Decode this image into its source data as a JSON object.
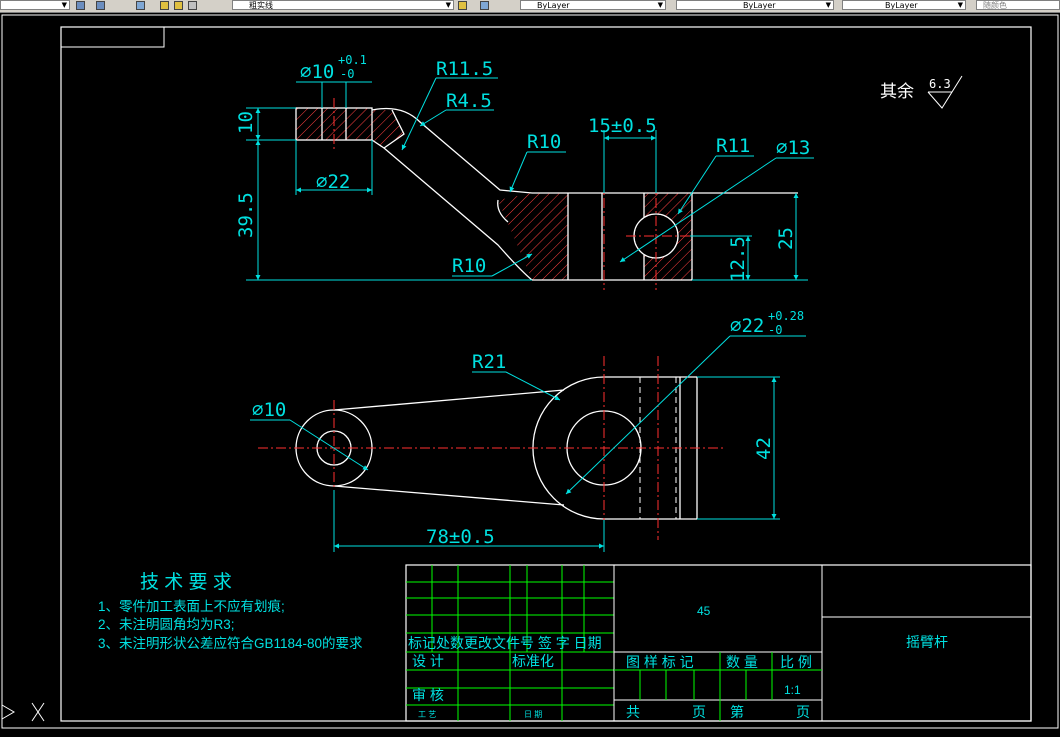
{
  "toolbar": {
    "layer_name": "粗实线",
    "color_value": "ByLayer",
    "linetype_value": "ByLayer",
    "lineweight_value": "ByLayer",
    "plotstyle_value": "随颜色"
  },
  "drawing": {
    "roughness_prefix": "其余",
    "roughness_value": "6.3",
    "dims": {
      "dia10_top": "⌀10",
      "tol_plus_01": "+0.1",
      "tol_minus_0a": "-0",
      "r11_5": "R11.5",
      "r4_5": "R4.5",
      "r10_upper": "R10",
      "r10_lower": "R10",
      "d10_vert": "10",
      "d39_5": "39.5",
      "dia22_top": "⌀22",
      "d15": "15±0.5",
      "r11": "R11",
      "dia13": "⌀13",
      "d25": "25",
      "d12_5": "12.5",
      "dia22_bottom": "⌀22",
      "tol_plus_028": "+0.28",
      "tol_minus_0b": "-0",
      "r21": "R21",
      "dia10_bottom": "⌀10",
      "d42": "42",
      "d78": "78±0.5"
    },
    "tech_req": {
      "title": "技 术 要 求",
      "item1": "1、零件加工表面上不应有划痕;",
      "item2": "2、未注明圆角均为R3;",
      "item3": "3、未注明形状公差应符合GB1184-80的要求"
    },
    "title_block": {
      "material": "45",
      "part_name": "摇臂杆",
      "rev_header": "标记处数更改文件号 签 字 日期",
      "design": "设 计",
      "standard": "标准化",
      "review": "审 核",
      "craft": "工 艺",
      "approve": "日 期",
      "drawing_mark": "图 样 标 记",
      "quantity": "数 量",
      "scale_label": "比 例",
      "scale_value": "1:1",
      "total": "共",
      "sheet": "页",
      "no": "第",
      "sheet2": "页"
    }
  }
}
